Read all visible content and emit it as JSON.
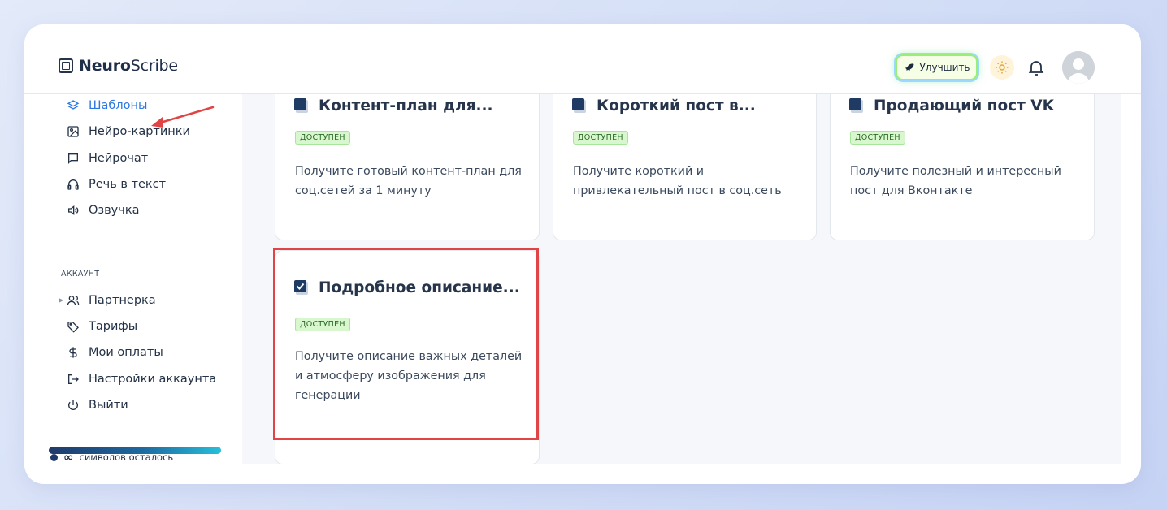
{
  "app": {
    "logo_bold": "Neuro",
    "logo_rest": "Scribe"
  },
  "header": {
    "upgrade_label": "Улучшить",
    "icons": [
      "rocket-icon",
      "sun-icon",
      "bell-icon",
      "avatar"
    ]
  },
  "sidebar": {
    "items": [
      {
        "label": "Шаблоны",
        "icon": "layers-icon",
        "active": true
      },
      {
        "label": "Нейро-картинки",
        "icon": "image-icon"
      },
      {
        "label": "Нейрочат",
        "icon": "chat-icon"
      },
      {
        "label": "Речь в текст",
        "icon": "headphones-icon"
      },
      {
        "label": "Озвучка",
        "icon": "speaker-icon"
      }
    ],
    "section_label": "АККАУНТ",
    "account_items": [
      {
        "label": "Партнерка",
        "icon": "users-icon"
      },
      {
        "label": "Тарифы",
        "icon": "tag-icon"
      },
      {
        "label": "Мои оплаты",
        "icon": "dollar-icon"
      },
      {
        "label": "Настройки аккаунта",
        "icon": "logout-arrow-icon"
      },
      {
        "label": "Выйти",
        "icon": "power-icon"
      }
    ],
    "symbols_infinity": "∞",
    "symbols_label": "символов осталось"
  },
  "templates": [
    {
      "title": "Контент-план для...",
      "badge": "ДОСТУПЕН",
      "desc": "Получите готовый контент-план для соц.сетей за 1 минуту"
    },
    {
      "title": "Короткий пост в...",
      "badge": "ДОСТУПЕН",
      "desc": "Получите короткий и привлекательный пост в соц.сеть"
    },
    {
      "title": "Продающий пост VK",
      "badge": "ДОСТУПЕН",
      "desc": "Получите полезный и интересный пост для Вконтакте"
    },
    {
      "title": "Подробное описание...",
      "badge": "ДОСТУПЕН",
      "desc": "Получите описание важных деталей и атмосферу изображения для генерации"
    }
  ],
  "colors": {
    "accent": "#2c77e2",
    "badge_bg": "#d9f7cf",
    "highlight": "#e14444"
  }
}
